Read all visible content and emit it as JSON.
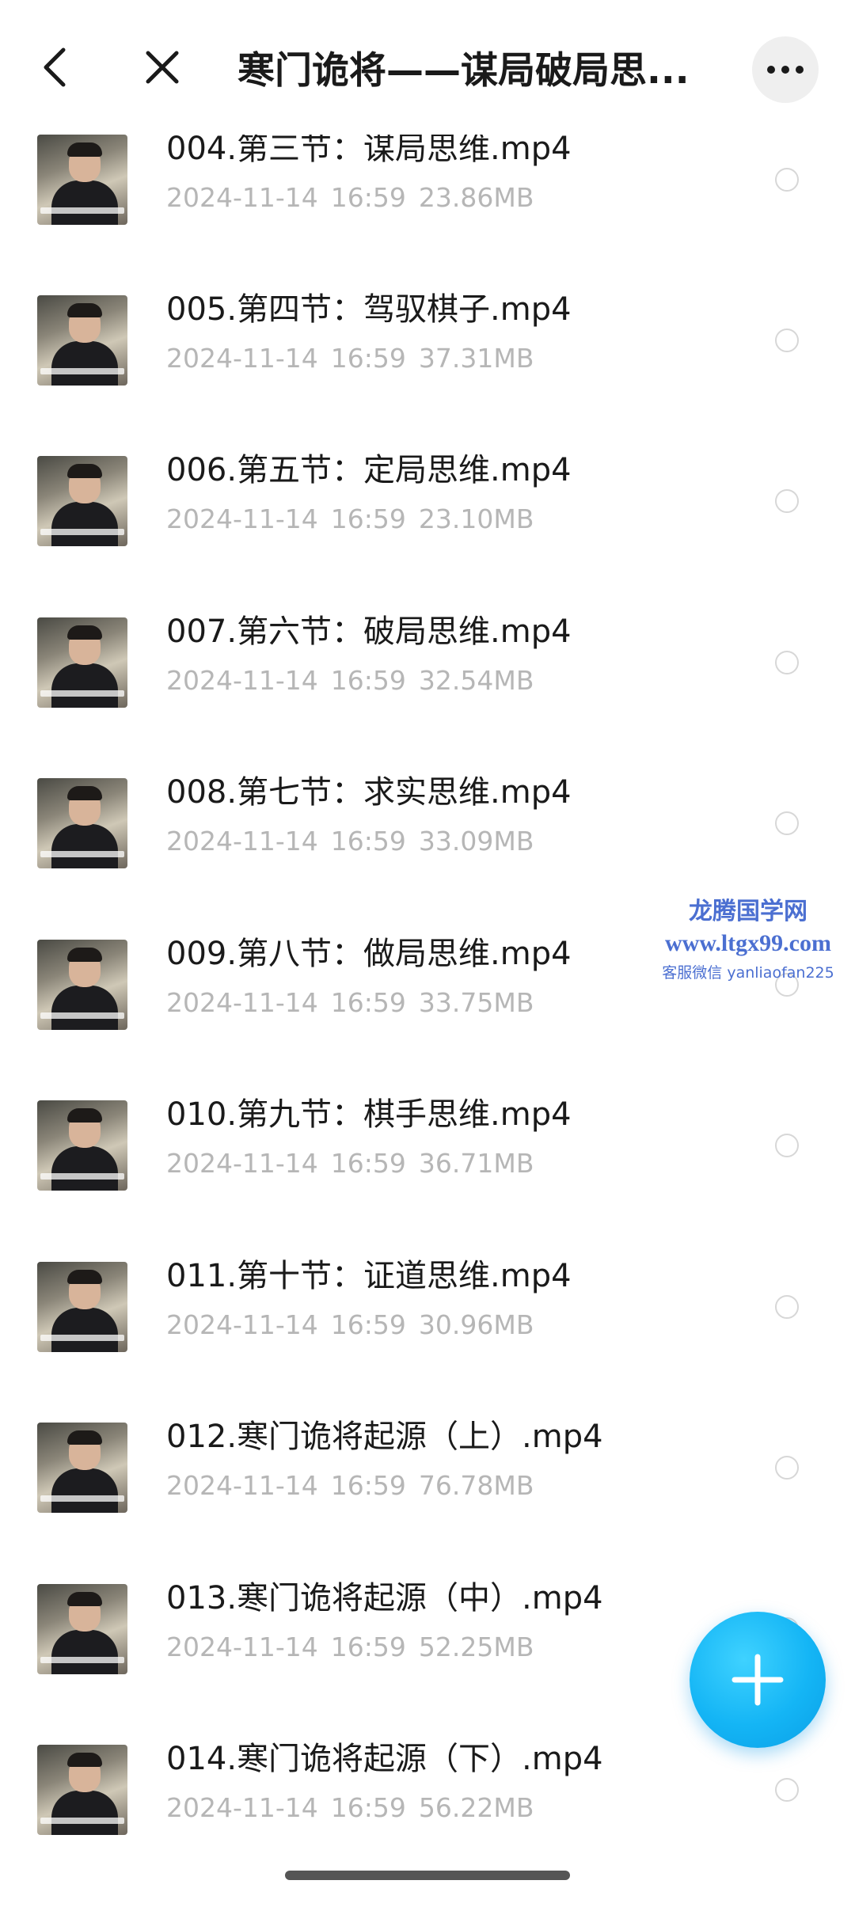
{
  "header": {
    "title": "寒门诡将——谋局破局思..."
  },
  "files": [
    {
      "name": "004.第三节：谋局思维.mp4",
      "date": "2024-11-14",
      "time": "16:59",
      "size": "23.86MB"
    },
    {
      "name": "005.第四节：驾驭棋子.mp4",
      "date": "2024-11-14",
      "time": "16:59",
      "size": "37.31MB"
    },
    {
      "name": "006.第五节：定局思维.mp4",
      "date": "2024-11-14",
      "time": "16:59",
      "size": "23.10MB"
    },
    {
      "name": "007.第六节：破局思维.mp4",
      "date": "2024-11-14",
      "time": "16:59",
      "size": "32.54MB"
    },
    {
      "name": "008.第七节：求实思维.mp4",
      "date": "2024-11-14",
      "time": "16:59",
      "size": "33.09MB"
    },
    {
      "name": "009.第八节：做局思维.mp4",
      "date": "2024-11-14",
      "time": "16:59",
      "size": "33.75MB"
    },
    {
      "name": "010.第九节：棋手思维.mp4",
      "date": "2024-11-14",
      "time": "16:59",
      "size": "36.71MB"
    },
    {
      "name": "011.第十节：证道思维.mp4",
      "date": "2024-11-14",
      "time": "16:59",
      "size": "30.96MB"
    },
    {
      "name": "012.寒门诡将起源（上）.mp4",
      "date": "2024-11-14",
      "time": "16:59",
      "size": "76.78MB"
    },
    {
      "name": "013.寒门诡将起源（中）.mp4",
      "date": "2024-11-14",
      "time": "16:59",
      "size": "52.25MB"
    },
    {
      "name": "014.寒门诡将起源（下）.mp4",
      "date": "2024-11-14",
      "time": "16:59",
      "size": "56.22MB"
    }
  ],
  "watermark": {
    "line1": "龙腾国学网",
    "line2": "www.ltgx99.com",
    "line3": "客服微信 yanliaofan225"
  },
  "icons": {
    "back": "chevron-left-icon",
    "close": "close-icon",
    "more": "more-horizontal-icon",
    "add": "plus-icon"
  },
  "colors": {
    "accent": "#14b5f5",
    "meta_text": "#b6b6b6",
    "watermark": "#4b6fd1"
  }
}
